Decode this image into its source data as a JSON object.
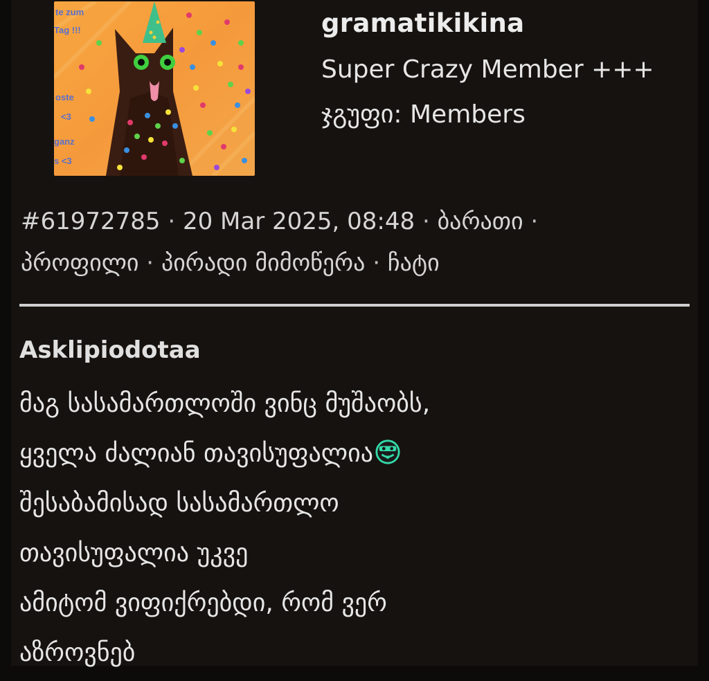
{
  "user": {
    "name": "gramatikikina",
    "rank": "Super Crazy Member +++",
    "group": "ჯგუფი: Members",
    "avatar_icon": "party-cat-avatar",
    "avatar_text": [
      "te zum",
      "Tag !!!",
      "oste",
      "<3",
      "ganz",
      "s <3"
    ]
  },
  "meta": {
    "post_id": "#61972785",
    "date": "20 Mar 2025, 08:48",
    "separator": " · ",
    "links": [
      "ბარათი",
      "პროფილი",
      "პირადი მიმოწერა",
      "ჩატი"
    ]
  },
  "post": {
    "author": "Asklipiodotaa",
    "lines": [
      "მაგ სასამართლოში ვინც მუშაობს,",
      "ყველა ძალიან თავისუფალია",
      "შესაბამისად სასამართლო",
      "თავისუფალია უკვე",
      "ამიტომ ვიფიქრებდი, რომ ვერ",
      "აზროვნებ"
    ],
    "emoji_icon": "tongue-out-smiley-icon"
  },
  "colors": {
    "page_bg": "#0c0b0a",
    "post_bg": "#16120f",
    "divider": "#cfcfcf",
    "emoji": "#34d9a8"
  }
}
